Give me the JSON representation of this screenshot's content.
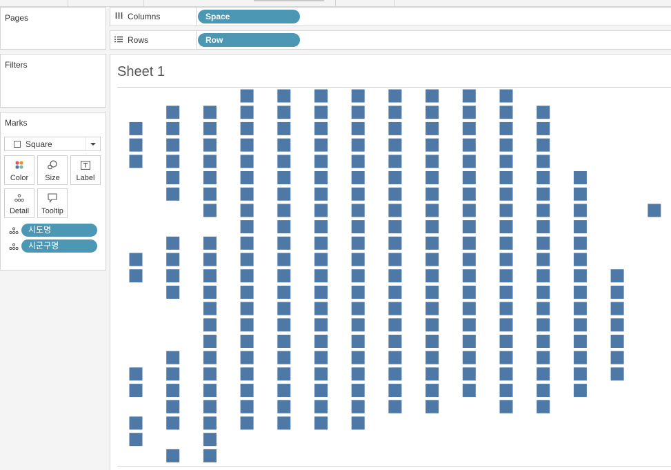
{
  "pages_panel": {
    "title": "Pages"
  },
  "filters_panel": {
    "title": "Filters"
  },
  "marks_panel": {
    "title": "Marks",
    "mark_type": "Square",
    "buttons": {
      "color": "Color",
      "size": "Size",
      "label": "Label",
      "detail": "Detail",
      "tooltip": "Tooltip"
    },
    "fields": [
      "시도명",
      "시군구명"
    ]
  },
  "columns_shelf": {
    "label": "Columns",
    "pill": "Space"
  },
  "rows_shelf": {
    "label": "Rows",
    "pill": "Row"
  },
  "sheet": {
    "title": "Sheet 1"
  },
  "colors": {
    "mark": "#4e79a7",
    "pill": "#4b97b4"
  },
  "chart_data": {
    "type": "scatter",
    "mark": "square",
    "title": "Sheet 1",
    "xlabel": "Space",
    "ylabel": "Row",
    "columns": [
      {
        "x": 1,
        "rows": [
          3,
          4,
          5,
          11,
          12,
          18,
          19,
          21,
          22
        ]
      },
      {
        "x": 2,
        "rows": [
          2,
          3,
          4,
          5,
          6,
          7,
          10,
          11,
          12,
          13,
          17,
          18,
          19,
          20,
          21,
          23
        ]
      },
      {
        "x": 3,
        "rows": [
          2,
          3,
          4,
          5,
          6,
          7,
          8,
          10,
          11,
          12,
          13,
          14,
          15,
          16,
          17,
          18,
          19,
          20,
          21,
          22,
          23
        ]
      },
      {
        "x": 4,
        "rows": [
          1,
          2,
          3,
          4,
          5,
          6,
          7,
          8,
          9,
          10,
          11,
          12,
          13,
          14,
          15,
          16,
          17,
          18,
          19,
          20,
          21
        ]
      },
      {
        "x": 5,
        "rows": [
          1,
          2,
          3,
          4,
          5,
          6,
          7,
          8,
          9,
          10,
          11,
          12,
          13,
          14,
          15,
          16,
          17,
          18,
          19,
          20,
          21
        ]
      },
      {
        "x": 6,
        "rows": [
          1,
          2,
          3,
          4,
          5,
          6,
          7,
          8,
          9,
          10,
          11,
          12,
          13,
          14,
          15,
          16,
          17,
          18,
          19,
          20,
          21
        ]
      },
      {
        "x": 7,
        "rows": [
          1,
          2,
          3,
          4,
          5,
          6,
          7,
          8,
          9,
          10,
          11,
          12,
          13,
          14,
          15,
          16,
          17,
          18,
          19,
          20,
          21
        ]
      },
      {
        "x": 8,
        "rows": [
          1,
          2,
          3,
          4,
          5,
          6,
          7,
          8,
          9,
          10,
          11,
          12,
          13,
          14,
          15,
          16,
          17,
          18,
          19,
          20
        ]
      },
      {
        "x": 9,
        "rows": [
          1,
          2,
          3,
          4,
          5,
          6,
          7,
          8,
          9,
          10,
          11,
          12,
          13,
          14,
          15,
          16,
          17,
          18,
          19,
          20
        ]
      },
      {
        "x": 10,
        "rows": [
          1,
          2,
          3,
          4,
          5,
          6,
          7,
          8,
          9,
          10,
          11,
          12,
          13,
          14,
          15,
          16,
          17,
          18,
          19
        ]
      },
      {
        "x": 11,
        "rows": [
          1,
          2,
          3,
          4,
          5,
          6,
          7,
          8,
          9,
          10,
          11,
          12,
          13,
          14,
          15,
          16,
          17,
          18,
          19,
          20
        ]
      },
      {
        "x": 12,
        "rows": [
          2,
          3,
          4,
          5,
          6,
          7,
          8,
          9,
          10,
          11,
          12,
          13,
          14,
          15,
          16,
          17,
          18,
          19,
          20
        ]
      },
      {
        "x": 13,
        "rows": [
          6,
          7,
          8,
          9,
          10,
          11,
          12,
          13,
          14,
          15,
          16,
          17,
          18,
          19
        ]
      },
      {
        "x": 14,
        "rows": [
          12,
          13,
          14,
          15,
          16,
          17,
          18
        ]
      },
      {
        "x": 15,
        "rows": [
          8
        ]
      }
    ]
  }
}
